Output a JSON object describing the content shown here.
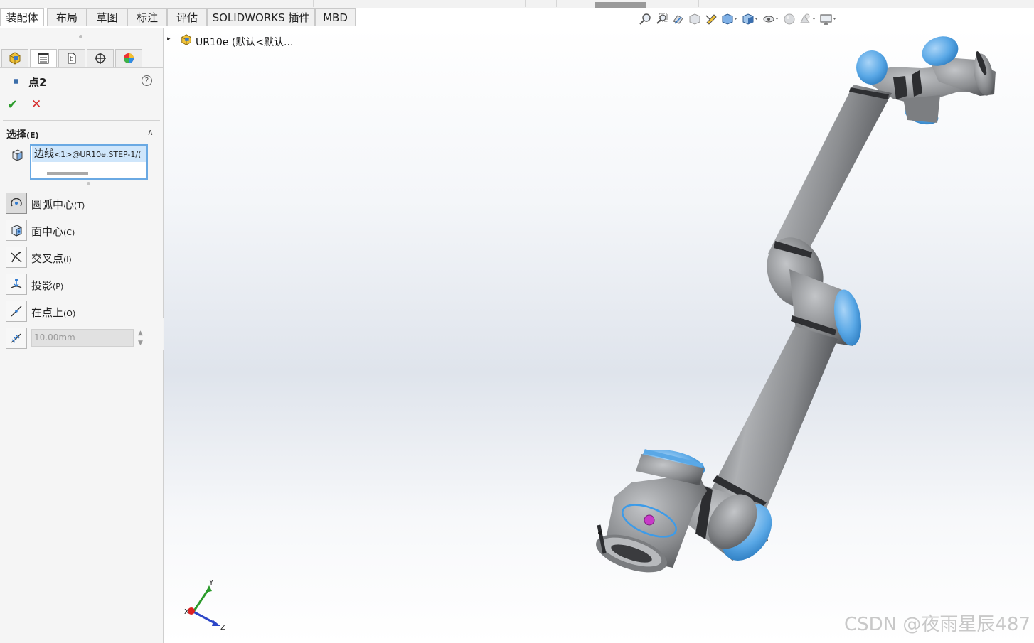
{
  "tabs": [
    {
      "label": "装配体"
    },
    {
      "label": "布局"
    },
    {
      "label": "草图"
    },
    {
      "label": "标注"
    },
    {
      "label": "评估"
    },
    {
      "label": "SOLIDWORKS 插件"
    },
    {
      "label": "MBD"
    }
  ],
  "active_tab": "装配体",
  "panel": {
    "tabs": [
      {
        "icon": "feature-manager-icon"
      },
      {
        "icon": "property-manager-icon"
      },
      {
        "icon": "configuration-manager-icon"
      },
      {
        "icon": "dimxpert-icon"
      },
      {
        "icon": "display-manager-icon"
      }
    ],
    "title": "点2",
    "ok_symbol": "✔",
    "cancel_symbol": "✕",
    "help_symbol": "?",
    "section": {
      "title": "选择",
      "shortcut": "(E)",
      "collapse_symbol": "∧"
    },
    "selection": {
      "prefix": "边线",
      "suffix": "<1>@UR10e.STEP-1/("
    },
    "options": [
      {
        "label": "圆弧中心",
        "shortcut": "(T)",
        "icon": "arc-center-icon",
        "active": true
      },
      {
        "label": "面中心",
        "shortcut": "(C)",
        "icon": "face-center-icon",
        "active": false
      },
      {
        "label": "交叉点",
        "shortcut": "(I)",
        "icon": "intersection-icon",
        "active": false
      },
      {
        "label": "投影",
        "shortcut": "(P)",
        "icon": "projection-icon",
        "active": false
      },
      {
        "label": "在点上",
        "shortcut": "(O)",
        "icon": "on-point-icon",
        "active": false
      }
    ],
    "distance": {
      "value": "10.00mm",
      "icon": "along-curve-distance-icon"
    }
  },
  "tree": {
    "expand_symbol": "▸",
    "label": "UR10e  (默认<默认...",
    "icon": "assembly-icon"
  },
  "hud_icons": [
    "zoom-to-fit-icon",
    "zoom-to-area-icon",
    "previous-view-icon",
    "section-view-icon",
    "dynamic-annotation-icon",
    "view-orientation-icon",
    "display-style-icon",
    "hide-show-items-icon",
    "edit-appearance-icon",
    "apply-scene-icon",
    "view-settings-icon"
  ],
  "triad": {
    "x": "X",
    "y": "Y",
    "z": "Z"
  },
  "watermark": "CSDN @夜雨星辰487",
  "colors": {
    "robot_body": "#8a8c8f",
    "robot_cap": "#5aa8e6",
    "selection_edge": "#3d9be8",
    "point_marker": "#c83ac8"
  }
}
